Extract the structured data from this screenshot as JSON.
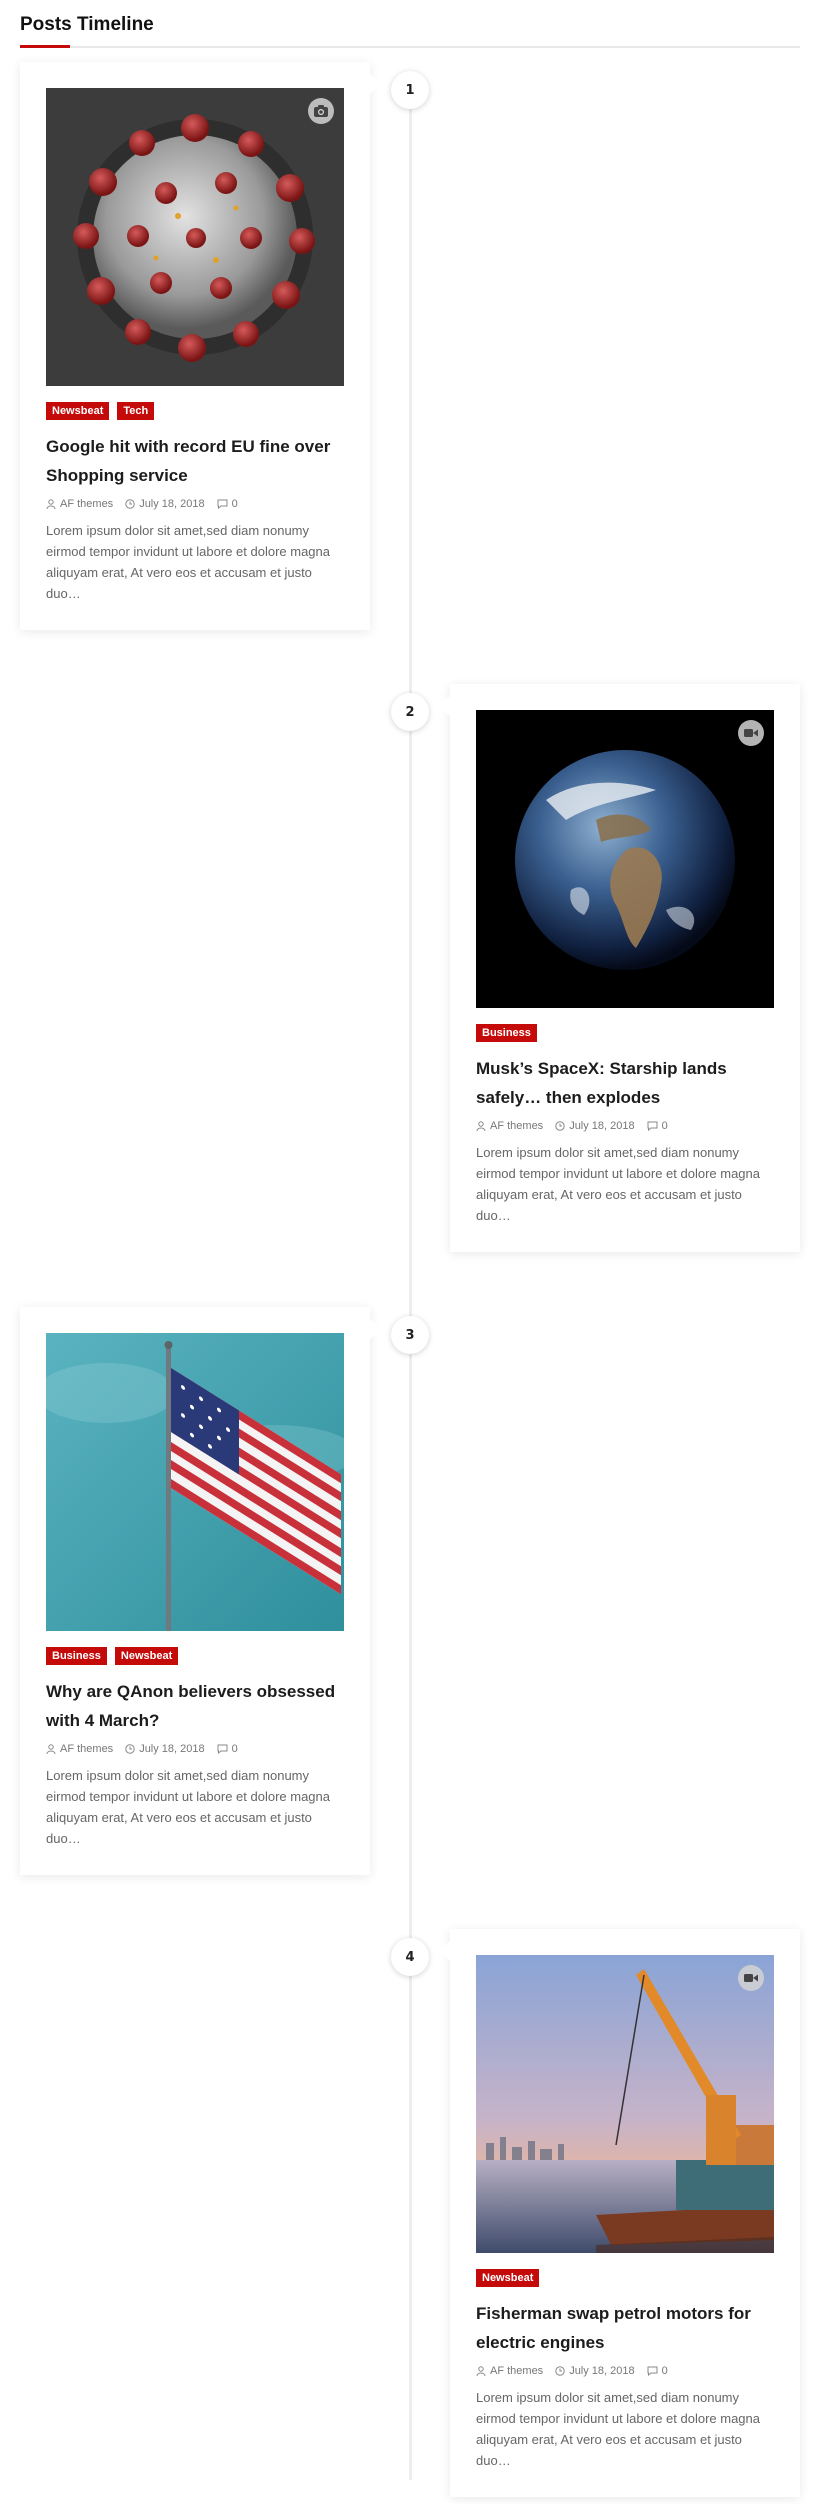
{
  "header": {
    "title": "Posts Timeline"
  },
  "posts": [
    {
      "number": "1",
      "categories": [
        "Newsbeat",
        "Tech"
      ],
      "title": "Google hit with record EU fine over Shopping service",
      "author": "AF themes",
      "date": "July 18, 2018",
      "comments": "0",
      "excerpt": "Lorem ipsum dolor sit amet,sed diam nonumy eirmod tempor invidunt ut labore et dolore magna aliquyam erat, At vero eos et accusam et justo duo…",
      "media_icon": "camera-icon",
      "image": "coronavirus-illustration"
    },
    {
      "number": "2",
      "categories": [
        "Business"
      ],
      "title": "Musk’s SpaceX: Starship lands safely… then explodes",
      "author": "AF themes",
      "date": "July 18, 2018",
      "comments": "0",
      "excerpt": "Lorem ipsum dolor sit amet,sed diam nonumy eirmod tempor invidunt ut labore et dolore magna aliquyam erat, At vero eos et accusam et justo duo…",
      "media_icon": "video-icon",
      "image": "earth-from-space"
    },
    {
      "number": "3",
      "categories": [
        "Business",
        "Newsbeat"
      ],
      "title": "Why are QAnon believers obsessed with 4 March?",
      "author": "AF themes",
      "date": "July 18, 2018",
      "comments": "0",
      "excerpt": "Lorem ipsum dolor sit amet,sed diam nonumy eirmod tempor invidunt ut labore et dolore magna aliquyam erat, At vero eos et accusam et justo duo…",
      "media_icon": "",
      "image": "us-flag-on-pole"
    },
    {
      "number": "4",
      "categories": [
        "Newsbeat"
      ],
      "title": "Fisherman swap petrol motors for electric engines",
      "author": "AF themes",
      "date": "July 18, 2018",
      "comments": "0",
      "excerpt": "Lorem ipsum dolor sit amet,sed diam nonumy eirmod tempor invidunt ut labore et dolore magna aliquyam erat, At vero eos et accusam et justo duo…",
      "media_icon": "video-icon",
      "image": "crane-ship-at-sunset"
    }
  ],
  "colors": {
    "accent": "#c50a0a",
    "timeline": "#eeeeee"
  }
}
